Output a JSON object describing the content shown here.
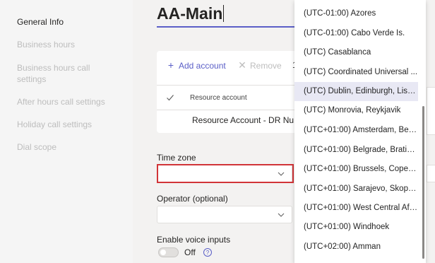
{
  "nav": {
    "items": [
      {
        "label": "General Info"
      },
      {
        "label": "Business hours"
      },
      {
        "label": "Business hours call settings"
      },
      {
        "label": "After hours call settings"
      },
      {
        "label": "Holiday call settings"
      },
      {
        "label": "Dial scope"
      }
    ]
  },
  "page": {
    "title": "AA-Main"
  },
  "resource_accounts": {
    "add_label": "Add account",
    "remove_label": "Remove",
    "toolbar_fragment": "1",
    "column_header": "Resource account",
    "rows": [
      {
        "name": "Resource Account - DR Nu..."
      }
    ]
  },
  "form": {
    "time_zone_label": "Time zone",
    "time_zone_value": "",
    "operator_label": "Operator (optional)",
    "operator_value": "",
    "voice_inputs_label": "Enable voice inputs",
    "voice_inputs_state": "Off"
  },
  "timezone_list": {
    "options": [
      {
        "label": "(UTC-01:00) Azores"
      },
      {
        "label": "(UTC-01:00) Cabo Verde Is."
      },
      {
        "label": "(UTC) Casablanca"
      },
      {
        "label": "(UTC) Coordinated Universal ..."
      },
      {
        "label": "(UTC) Dublin, Edinburgh, Lisb..."
      },
      {
        "label": "(UTC) Monrovia, Reykjavik"
      },
      {
        "label": "(UTC+01:00) Amsterdam, Berl..."
      },
      {
        "label": "(UTC+01:00) Belgrade, Bratisl..."
      },
      {
        "label": "(UTC+01:00) Brussels, Copen..."
      },
      {
        "label": "(UTC+01:00) Sarajevo, Skopje,..."
      },
      {
        "label": "(UTC+01:00) West Central Afri..."
      },
      {
        "label": "(UTC+01:00) Windhoek"
      },
      {
        "label": "(UTC+02:00) Amman"
      }
    ],
    "highlighted": "(UTC) Dublin, Edinburgh, Lisb..."
  },
  "colors": {
    "accent": "#5b5fc7",
    "highlight_box": "#d13438",
    "selected_item_bg": "#e8e8f4",
    "muted_text": "#bdbdbd"
  },
  "icons": [
    "add-icon",
    "remove-icon",
    "check-icon",
    "chevron-down-icon",
    "info-icon"
  ]
}
